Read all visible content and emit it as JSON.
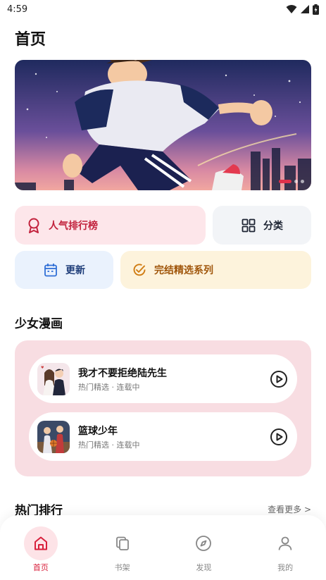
{
  "status_bar": {
    "time": "4:59"
  },
  "header": {
    "title": "首页"
  },
  "banner": {
    "slide_count": 3,
    "active_slide": 1
  },
  "quick_links": {
    "rank": "人气排行榜",
    "category": "分类",
    "update": "更新",
    "completed": "完结精选系列"
  },
  "sections": {
    "shoujo": {
      "title": "少女漫画",
      "items": [
        {
          "title": "我才不要拒绝陆先生",
          "subtitle": "热门精选 · 连载中"
        },
        {
          "title": "篮球少年",
          "subtitle": "热门精选 · 连载中"
        }
      ]
    },
    "hot": {
      "title": "热门排行",
      "more": "查看更多 >"
    }
  },
  "bottom_nav": [
    {
      "label": "首页",
      "icon": "home-icon",
      "active": true
    },
    {
      "label": "书架",
      "icon": "bookshelf-icon",
      "active": false
    },
    {
      "label": "发现",
      "icon": "compass-icon",
      "active": false
    },
    {
      "label": "我的",
      "icon": "user-icon",
      "active": false
    }
  ],
  "colors": {
    "accent": "#d8203c",
    "rank_bg": "#fde6ea",
    "shoujo_bg": "#f8dde2"
  }
}
